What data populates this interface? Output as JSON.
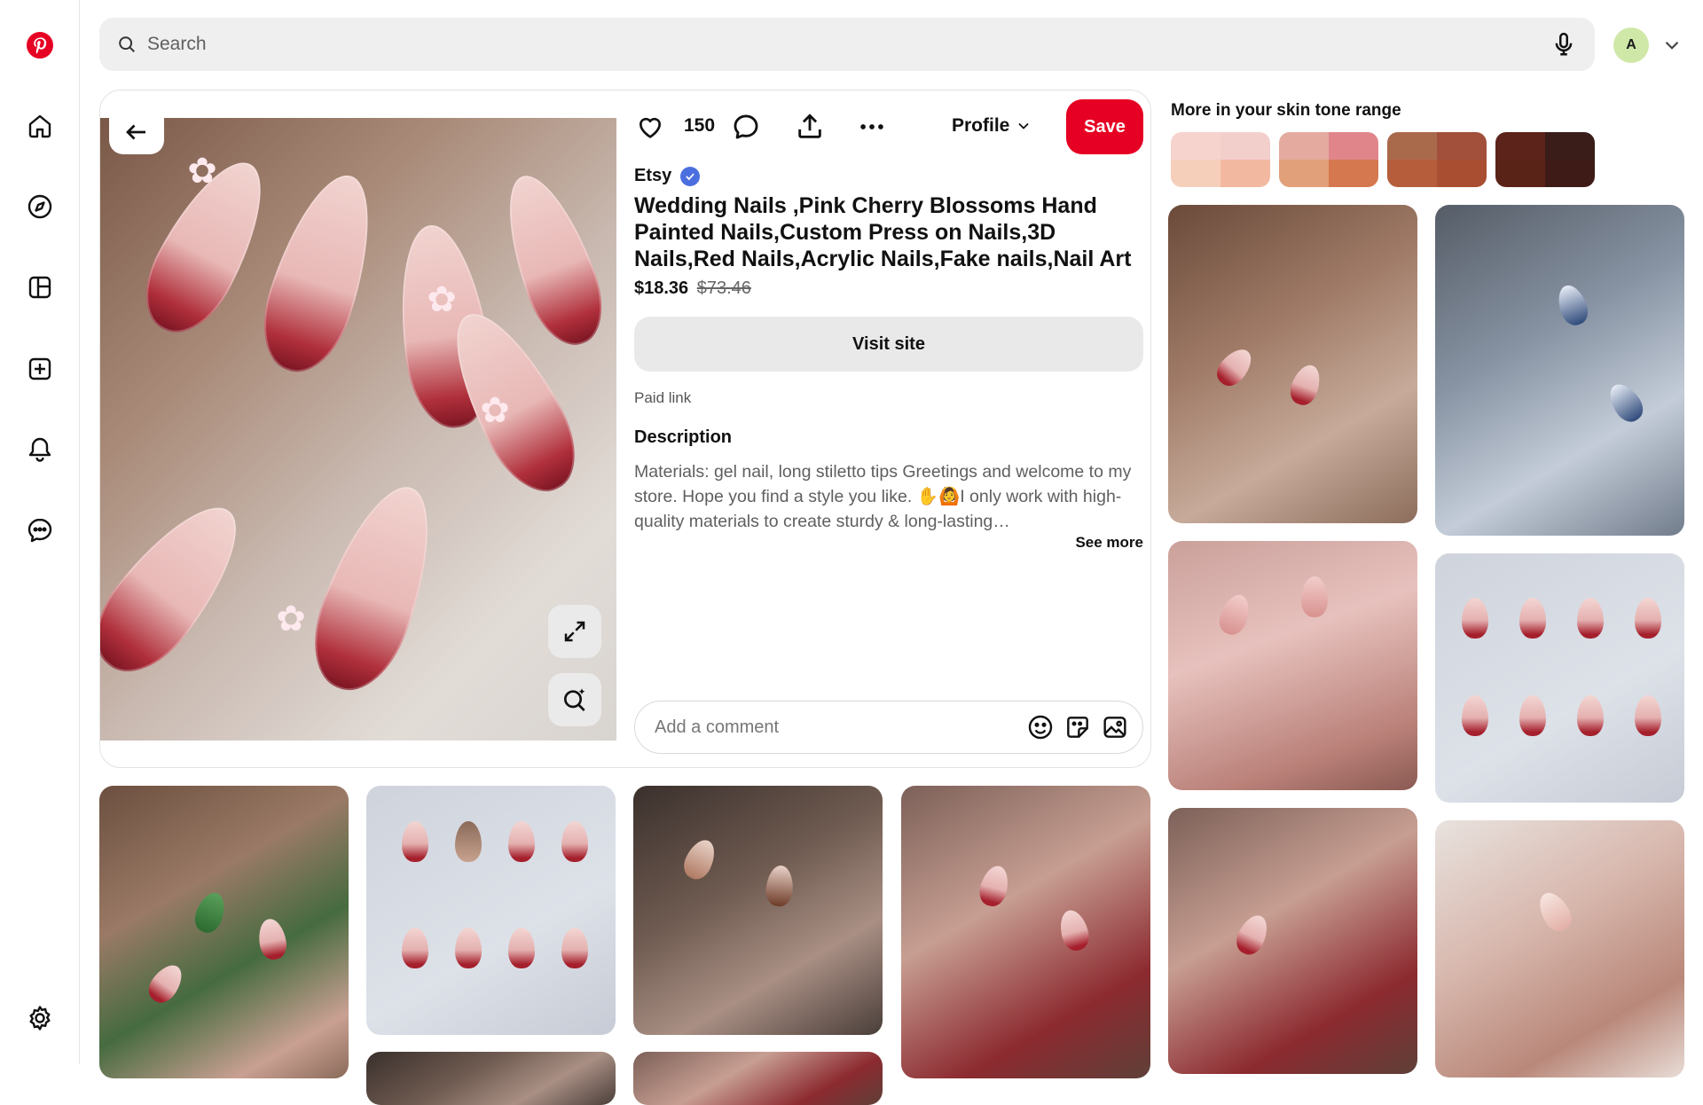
{
  "app": {
    "name": "Pinterest",
    "brand_color": "#e60023"
  },
  "sidebar": {
    "items": [
      {
        "name": "home",
        "icon": "home-icon"
      },
      {
        "name": "explore",
        "icon": "compass-icon"
      },
      {
        "name": "boards",
        "icon": "boards-icon"
      },
      {
        "name": "create",
        "icon": "plus-square-icon"
      },
      {
        "name": "notifications",
        "icon": "bell-icon"
      },
      {
        "name": "messages",
        "icon": "chat-icon"
      },
      {
        "name": "settings",
        "icon": "gear-icon"
      }
    ]
  },
  "search": {
    "placeholder": "Search"
  },
  "account": {
    "avatar_letter": "A",
    "avatar_color": "#cfe8a8"
  },
  "pin": {
    "like_count": "150",
    "profile_label": "Profile",
    "save_label": "Save",
    "merchant": "Etsy",
    "title": "Wedding Nails ,Pink Cherry Blossoms Hand Painted Nails,Custom Press on Nails,3D Nails,Red Nails,Acrylic Nails,Fake nails,Nail Art",
    "price": "$18.36",
    "original_price": "$73.46",
    "visit_label": "Visit site",
    "paid_link_label": "Paid link",
    "description_heading": "Description",
    "description": "Materials: gel nail, long stiletto tips Greetings and welcome to my store. Hope you find a style you like. ✋🙆I only work with high-quality materials to create sturdy & long-lasting…",
    "see_more_label": "See more",
    "comment_placeholder": "Add a comment"
  },
  "related": {
    "heading": "More in your skin tone range",
    "skin_tones": [
      [
        "#f6d3cd",
        "#f3cfcc",
        "#f6cfbb",
        "#f3b9a0"
      ],
      [
        "#e4aaa0",
        "#e0868a",
        "#e2a07a",
        "#d6784f"
      ],
      [
        "#a96a4c",
        "#a24f3b",
        "#b65d3c",
        "#a94e30"
      ],
      [
        "#5c231a",
        "#3a1c18",
        "#5a2318",
        "#3e1b16"
      ]
    ]
  }
}
